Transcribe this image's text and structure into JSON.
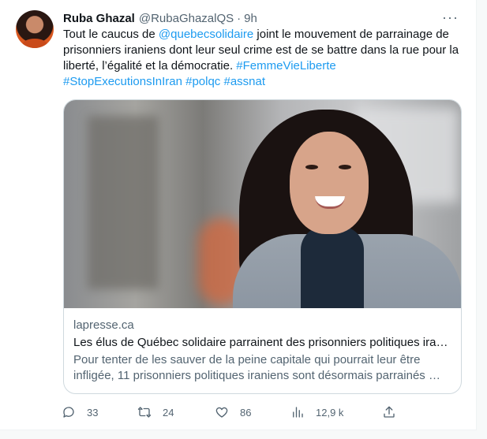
{
  "tweet": {
    "author_name": "Ruba Ghazal",
    "handle": "@RubaGhazalQS",
    "separator": "·",
    "time": "9h",
    "more_glyph": "···",
    "text": {
      "part1": "Tout le caucus de ",
      "mention": "@quebecsolidaire",
      "part2": " joint le mouvement de parrainage de prisonniers iraniens dont leur seul crime est de se battre dans la rue pour la liberté, l’égalité et la démocratie. ",
      "hashtag1": "#FemmeVieLiberte",
      "hashtag2": "#StopExecutionsInIran",
      "hashtag3": "#polqc",
      "hashtag4": "#assnat"
    },
    "card": {
      "domain": "lapresse.ca",
      "title": "Les élus de Québec solidaire parrainent des prisonniers politiques iran…",
      "description": "Pour tenter de les sauver de la peine capitale qui pourrait leur être infligée, 11 prisonniers politiques iraniens sont désormais parrainés …"
    },
    "actions": {
      "replies": "33",
      "retweets": "24",
      "likes": "86",
      "views": "12,9 k"
    }
  },
  "colors": {
    "link": "#1d9bf0",
    "secondary_text": "#536471",
    "primary_text": "#0f1419",
    "border": "#cfd9de"
  },
  "icons": [
    "reply-icon",
    "retweet-icon",
    "like-icon",
    "views-icon",
    "share-icon",
    "more-icon"
  ]
}
